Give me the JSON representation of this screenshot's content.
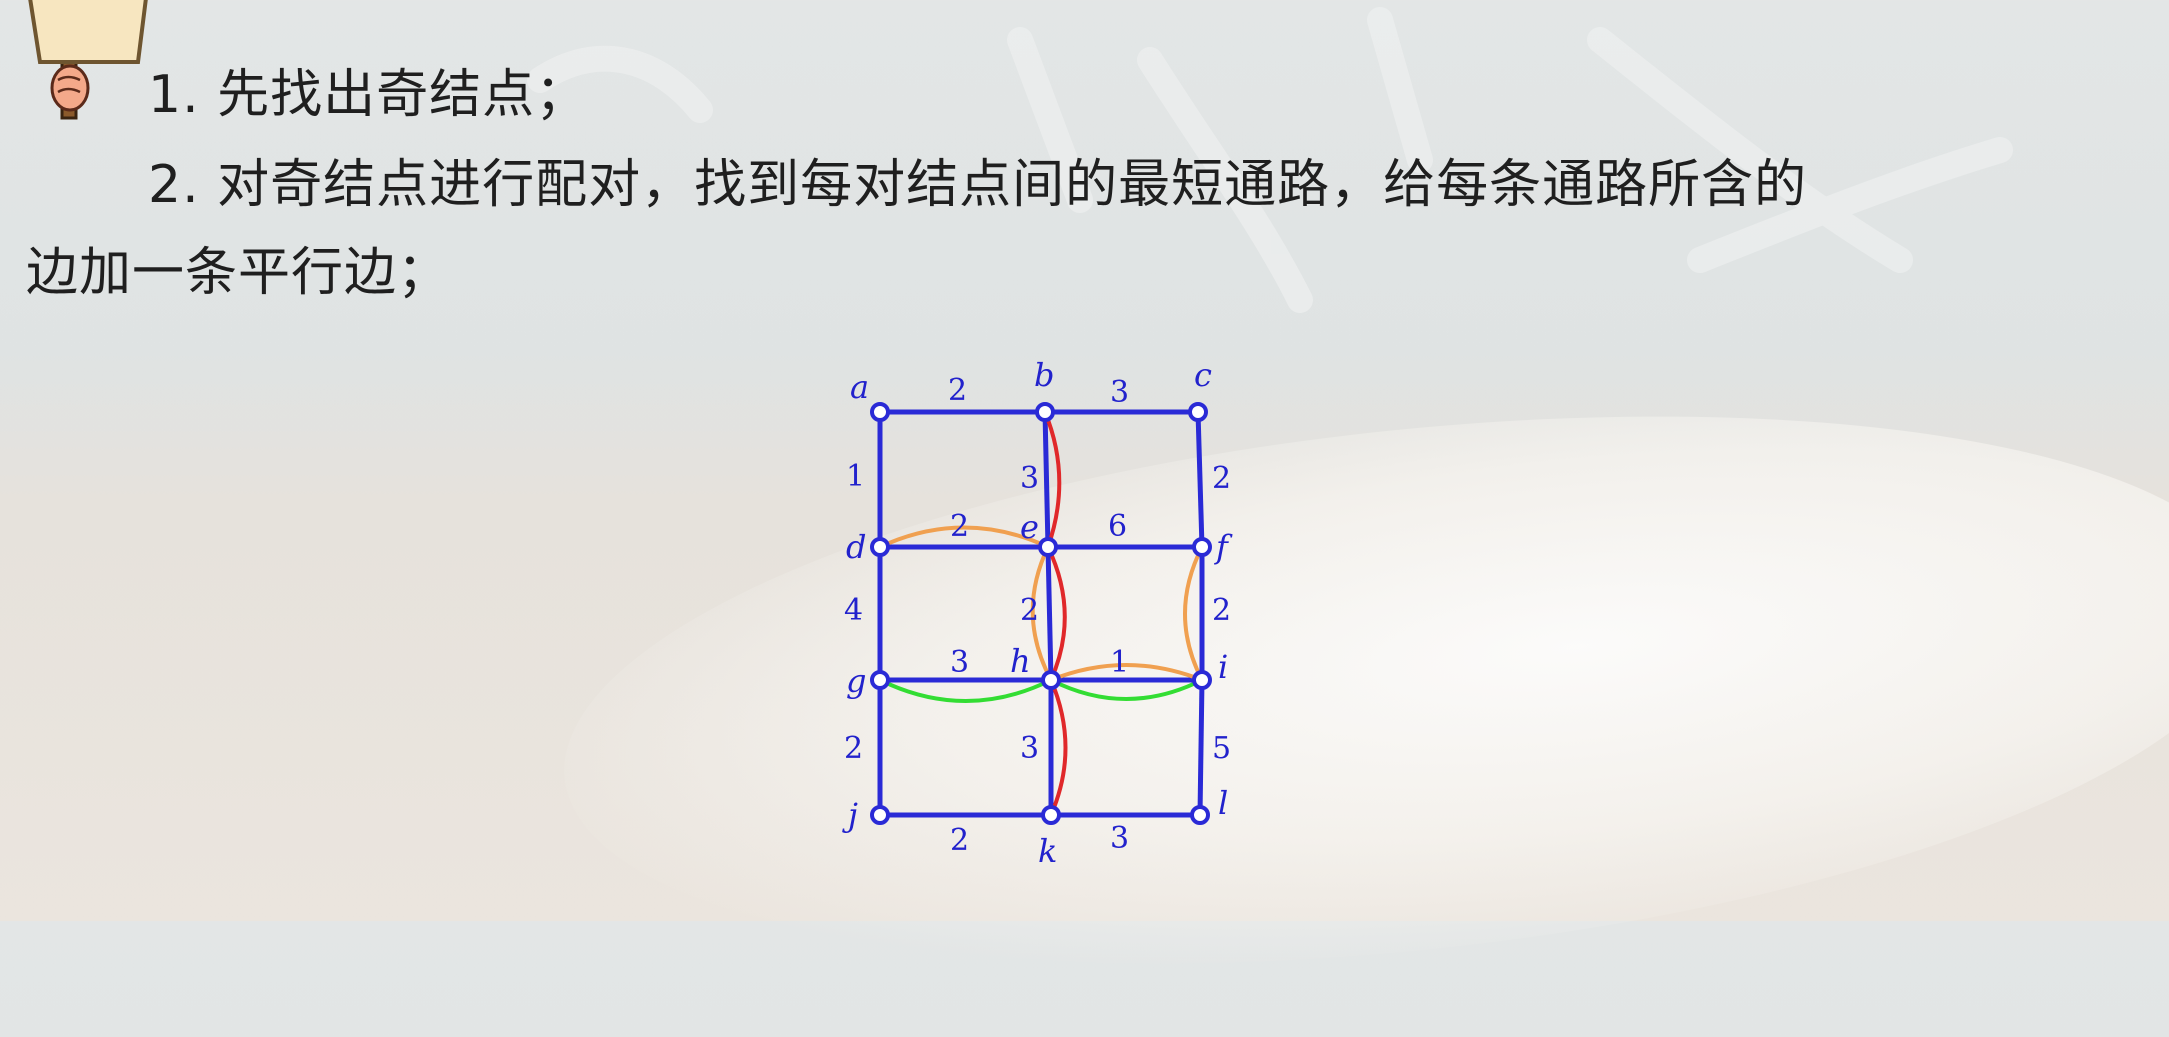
{
  "text": {
    "line1": "1. 先找出奇结点；",
    "line2": "2. 对奇结点进行配对，找到每对结点间的最短通路，给每条通路所含的",
    "line3": "边加一条平行边；"
  },
  "graph": {
    "vertices": {
      "a": "a",
      "b": "b",
      "c": "c",
      "d": "d",
      "e": "e",
      "f": "f",
      "g": "g",
      "h": "h",
      "i": "i",
      "j": "j",
      "k": "k",
      "l": "l"
    },
    "weights": {
      "ab": "2",
      "bc": "3",
      "ad": "1",
      "be": "3",
      "cf": "2",
      "de": "2",
      "ef": "6",
      "dg": "4",
      "eh": "2",
      "fi": "2",
      "gh": "3",
      "hi": "1",
      "gj": "2",
      "hk": "3",
      "il": "5",
      "jk": "2",
      "kl": "3"
    },
    "colors": {
      "edge": "#2a2ad6",
      "red_parallel": "#e0282a",
      "orange_parallel": "#f0a050",
      "green_parallel": "#33dd33"
    }
  }
}
